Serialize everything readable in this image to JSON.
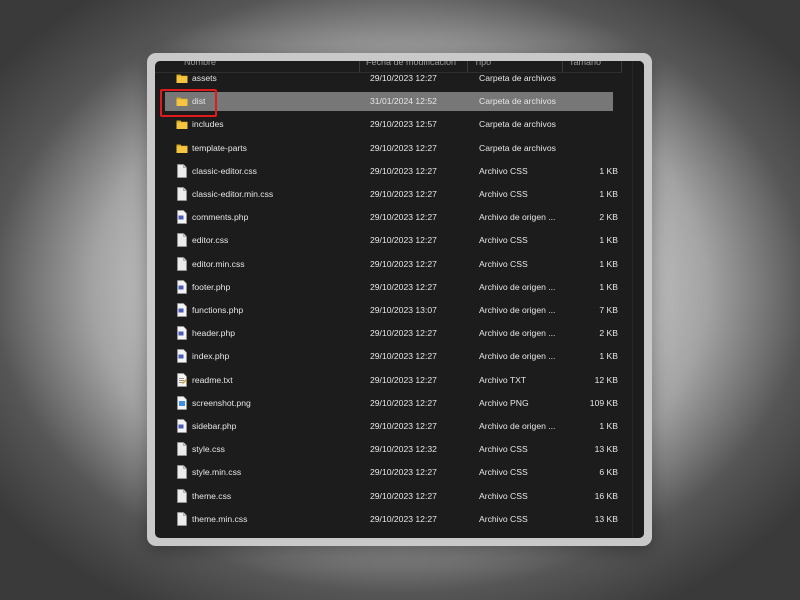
{
  "columns": {
    "name": "Nombre",
    "date": "Fecha de modificación",
    "type": "Tipo",
    "size": "Tamaño"
  },
  "files": [
    {
      "name": "assets",
      "date": "29/10/2023 12:27",
      "type": "Carpeta de archivos",
      "size": "",
      "icon": "folder-icon",
      "selected": false
    },
    {
      "name": "dist",
      "date": "31/01/2024 12:52",
      "type": "Carpeta de archivos",
      "size": "",
      "icon": "folder-icon",
      "selected": true
    },
    {
      "name": "includes",
      "date": "29/10/2023 12:57",
      "type": "Carpeta de archivos",
      "size": "",
      "icon": "folder-icon",
      "selected": false
    },
    {
      "name": "template-parts",
      "date": "29/10/2023 12:27",
      "type": "Carpeta de archivos",
      "size": "",
      "icon": "folder-icon",
      "selected": false
    },
    {
      "name": "classic-editor.css",
      "date": "29/10/2023 12:27",
      "type": "Archivo CSS",
      "size": "1 KB",
      "icon": "file-icon",
      "selected": false
    },
    {
      "name": "classic-editor.min.css",
      "date": "29/10/2023 12:27",
      "type": "Archivo CSS",
      "size": "1 KB",
      "icon": "file-icon",
      "selected": false
    },
    {
      "name": "comments.php",
      "date": "29/10/2023 12:27",
      "type": "Archivo de origen ...",
      "size": "2 KB",
      "icon": "php-file-icon",
      "selected": false
    },
    {
      "name": "editor.css",
      "date": "29/10/2023 12:27",
      "type": "Archivo CSS",
      "size": "1 KB",
      "icon": "file-icon",
      "selected": false
    },
    {
      "name": "editor.min.css",
      "date": "29/10/2023 12:27",
      "type": "Archivo CSS",
      "size": "1 KB",
      "icon": "file-icon",
      "selected": false
    },
    {
      "name": "footer.php",
      "date": "29/10/2023 12:27",
      "type": "Archivo de origen ...",
      "size": "1 KB",
      "icon": "php-file-icon",
      "selected": false
    },
    {
      "name": "functions.php",
      "date": "29/10/2023 13:07",
      "type": "Archivo de origen ...",
      "size": "7 KB",
      "icon": "php-file-icon",
      "selected": false
    },
    {
      "name": "header.php",
      "date": "29/10/2023 12:27",
      "type": "Archivo de origen ...",
      "size": "2 KB",
      "icon": "php-file-icon",
      "selected": false
    },
    {
      "name": "index.php",
      "date": "29/10/2023 12:27",
      "type": "Archivo de origen ...",
      "size": "1 KB",
      "icon": "php-file-icon",
      "selected": false
    },
    {
      "name": "readme.txt",
      "date": "29/10/2023 12:27",
      "type": "Archivo TXT",
      "size": "12 KB",
      "icon": "text-file-icon",
      "selected": false
    },
    {
      "name": "screenshot.png",
      "date": "29/10/2023 12:27",
      "type": "Archivo PNG",
      "size": "109 KB",
      "icon": "image-file-icon",
      "selected": false
    },
    {
      "name": "sidebar.php",
      "date": "29/10/2023 12:27",
      "type": "Archivo de origen ...",
      "size": "1 KB",
      "icon": "php-file-icon",
      "selected": false
    },
    {
      "name": "style.css",
      "date": "29/10/2023 12:32",
      "type": "Archivo CSS",
      "size": "13 KB",
      "icon": "file-icon",
      "selected": false
    },
    {
      "name": "style.min.css",
      "date": "29/10/2023 12:27",
      "type": "Archivo CSS",
      "size": "6 KB",
      "icon": "file-icon",
      "selected": false
    },
    {
      "name": "theme.css",
      "date": "29/10/2023 12:27",
      "type": "Archivo CSS",
      "size": "16 KB",
      "icon": "file-icon",
      "selected": false
    },
    {
      "name": "theme.min.css",
      "date": "29/10/2023 12:27",
      "type": "Archivo CSS",
      "size": "13 KB",
      "icon": "file-icon",
      "selected": false
    }
  ],
  "colors": {
    "background": "#1c1c1c",
    "selected_row": "#777777",
    "highlight": "#e01b1b",
    "folder": "#f5c542",
    "text": "#e6e6e6"
  }
}
